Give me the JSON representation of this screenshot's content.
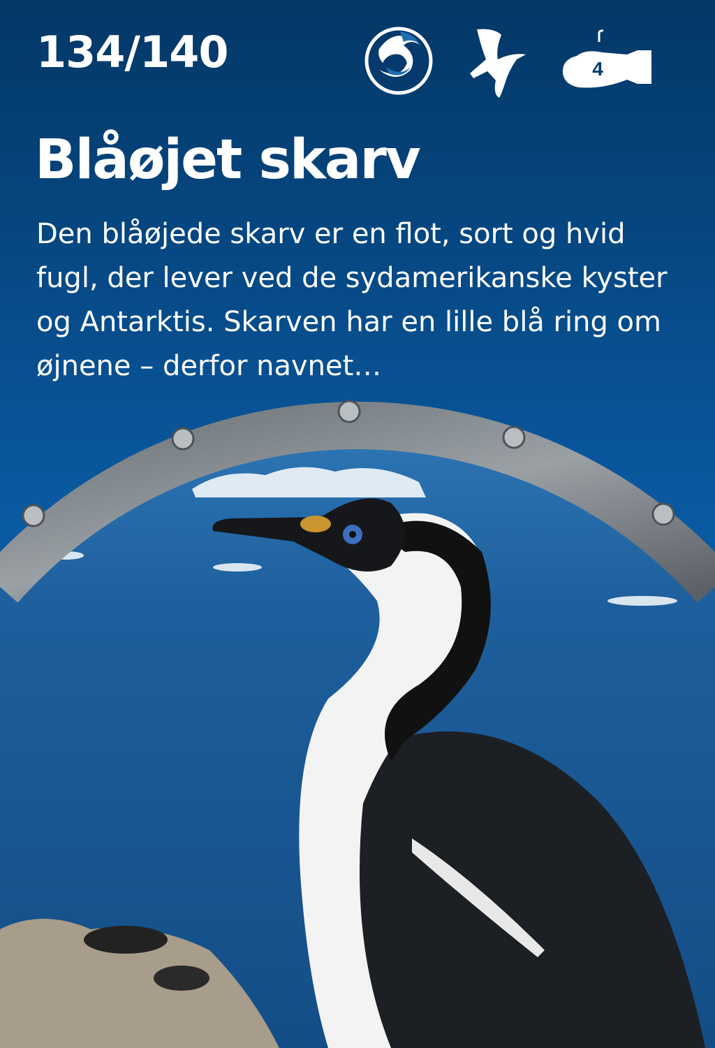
{
  "card": {
    "counter": "134/140",
    "title": "Blåøjet skarv",
    "description": "Den blåøjede skarv er en flot, sort og hvid fugl, der lever ved de sydamerikanske kyster og Antarktis. Skarven har en lille blå ring om øjnene – derfor navnet…",
    "icons": [
      {
        "name": "ocean-wave-icon"
      },
      {
        "name": "flying-bird-icon"
      },
      {
        "name": "submarine-icon",
        "value": "4"
      }
    ]
  },
  "colors": {
    "background_top": "#033766",
    "background_bottom": "#0a5aa2",
    "sea": "#1d5f9c",
    "icon_accent": "#1f6fb5"
  }
}
